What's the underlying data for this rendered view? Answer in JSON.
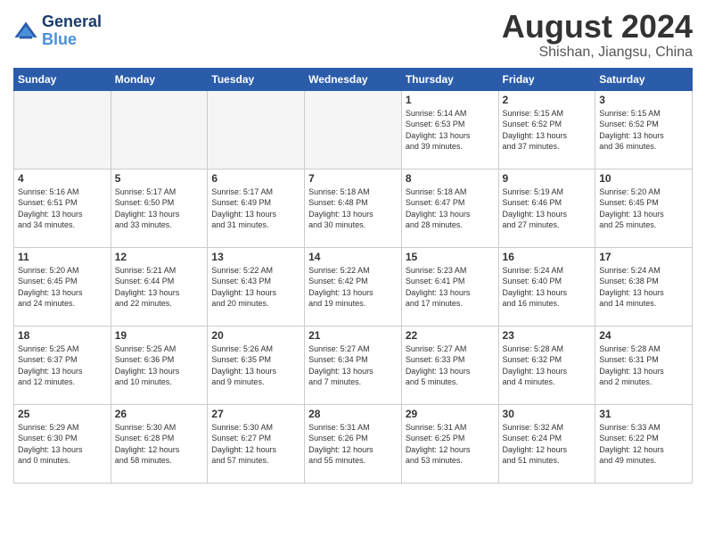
{
  "header": {
    "logo_line1": "General",
    "logo_line2": "Blue",
    "month_year": "August 2024",
    "location": "Shishan, Jiangsu, China"
  },
  "weekdays": [
    "Sunday",
    "Monday",
    "Tuesday",
    "Wednesday",
    "Thursday",
    "Friday",
    "Saturday"
  ],
  "weeks": [
    [
      {
        "day": "",
        "info": ""
      },
      {
        "day": "",
        "info": ""
      },
      {
        "day": "",
        "info": ""
      },
      {
        "day": "",
        "info": ""
      },
      {
        "day": "1",
        "info": "Sunrise: 5:14 AM\nSunset: 6:53 PM\nDaylight: 13 hours\nand 39 minutes."
      },
      {
        "day": "2",
        "info": "Sunrise: 5:15 AM\nSunset: 6:52 PM\nDaylight: 13 hours\nand 37 minutes."
      },
      {
        "day": "3",
        "info": "Sunrise: 5:15 AM\nSunset: 6:52 PM\nDaylight: 13 hours\nand 36 minutes."
      }
    ],
    [
      {
        "day": "4",
        "info": "Sunrise: 5:16 AM\nSunset: 6:51 PM\nDaylight: 13 hours\nand 34 minutes."
      },
      {
        "day": "5",
        "info": "Sunrise: 5:17 AM\nSunset: 6:50 PM\nDaylight: 13 hours\nand 33 minutes."
      },
      {
        "day": "6",
        "info": "Sunrise: 5:17 AM\nSunset: 6:49 PM\nDaylight: 13 hours\nand 31 minutes."
      },
      {
        "day": "7",
        "info": "Sunrise: 5:18 AM\nSunset: 6:48 PM\nDaylight: 13 hours\nand 30 minutes."
      },
      {
        "day": "8",
        "info": "Sunrise: 5:18 AM\nSunset: 6:47 PM\nDaylight: 13 hours\nand 28 minutes."
      },
      {
        "day": "9",
        "info": "Sunrise: 5:19 AM\nSunset: 6:46 PM\nDaylight: 13 hours\nand 27 minutes."
      },
      {
        "day": "10",
        "info": "Sunrise: 5:20 AM\nSunset: 6:45 PM\nDaylight: 13 hours\nand 25 minutes."
      }
    ],
    [
      {
        "day": "11",
        "info": "Sunrise: 5:20 AM\nSunset: 6:45 PM\nDaylight: 13 hours\nand 24 minutes."
      },
      {
        "day": "12",
        "info": "Sunrise: 5:21 AM\nSunset: 6:44 PM\nDaylight: 13 hours\nand 22 minutes."
      },
      {
        "day": "13",
        "info": "Sunrise: 5:22 AM\nSunset: 6:43 PM\nDaylight: 13 hours\nand 20 minutes."
      },
      {
        "day": "14",
        "info": "Sunrise: 5:22 AM\nSunset: 6:42 PM\nDaylight: 13 hours\nand 19 minutes."
      },
      {
        "day": "15",
        "info": "Sunrise: 5:23 AM\nSunset: 6:41 PM\nDaylight: 13 hours\nand 17 minutes."
      },
      {
        "day": "16",
        "info": "Sunrise: 5:24 AM\nSunset: 6:40 PM\nDaylight: 13 hours\nand 16 minutes."
      },
      {
        "day": "17",
        "info": "Sunrise: 5:24 AM\nSunset: 6:38 PM\nDaylight: 13 hours\nand 14 minutes."
      }
    ],
    [
      {
        "day": "18",
        "info": "Sunrise: 5:25 AM\nSunset: 6:37 PM\nDaylight: 13 hours\nand 12 minutes."
      },
      {
        "day": "19",
        "info": "Sunrise: 5:25 AM\nSunset: 6:36 PM\nDaylight: 13 hours\nand 10 minutes."
      },
      {
        "day": "20",
        "info": "Sunrise: 5:26 AM\nSunset: 6:35 PM\nDaylight: 13 hours\nand 9 minutes."
      },
      {
        "day": "21",
        "info": "Sunrise: 5:27 AM\nSunset: 6:34 PM\nDaylight: 13 hours\nand 7 minutes."
      },
      {
        "day": "22",
        "info": "Sunrise: 5:27 AM\nSunset: 6:33 PM\nDaylight: 13 hours\nand 5 minutes."
      },
      {
        "day": "23",
        "info": "Sunrise: 5:28 AM\nSunset: 6:32 PM\nDaylight: 13 hours\nand 4 minutes."
      },
      {
        "day": "24",
        "info": "Sunrise: 5:28 AM\nSunset: 6:31 PM\nDaylight: 13 hours\nand 2 minutes."
      }
    ],
    [
      {
        "day": "25",
        "info": "Sunrise: 5:29 AM\nSunset: 6:30 PM\nDaylight: 13 hours\nand 0 minutes."
      },
      {
        "day": "26",
        "info": "Sunrise: 5:30 AM\nSunset: 6:28 PM\nDaylight: 12 hours\nand 58 minutes."
      },
      {
        "day": "27",
        "info": "Sunrise: 5:30 AM\nSunset: 6:27 PM\nDaylight: 12 hours\nand 57 minutes."
      },
      {
        "day": "28",
        "info": "Sunrise: 5:31 AM\nSunset: 6:26 PM\nDaylight: 12 hours\nand 55 minutes."
      },
      {
        "day": "29",
        "info": "Sunrise: 5:31 AM\nSunset: 6:25 PM\nDaylight: 12 hours\nand 53 minutes."
      },
      {
        "day": "30",
        "info": "Sunrise: 5:32 AM\nSunset: 6:24 PM\nDaylight: 12 hours\nand 51 minutes."
      },
      {
        "day": "31",
        "info": "Sunrise: 5:33 AM\nSunset: 6:22 PM\nDaylight: 12 hours\nand 49 minutes."
      }
    ]
  ]
}
